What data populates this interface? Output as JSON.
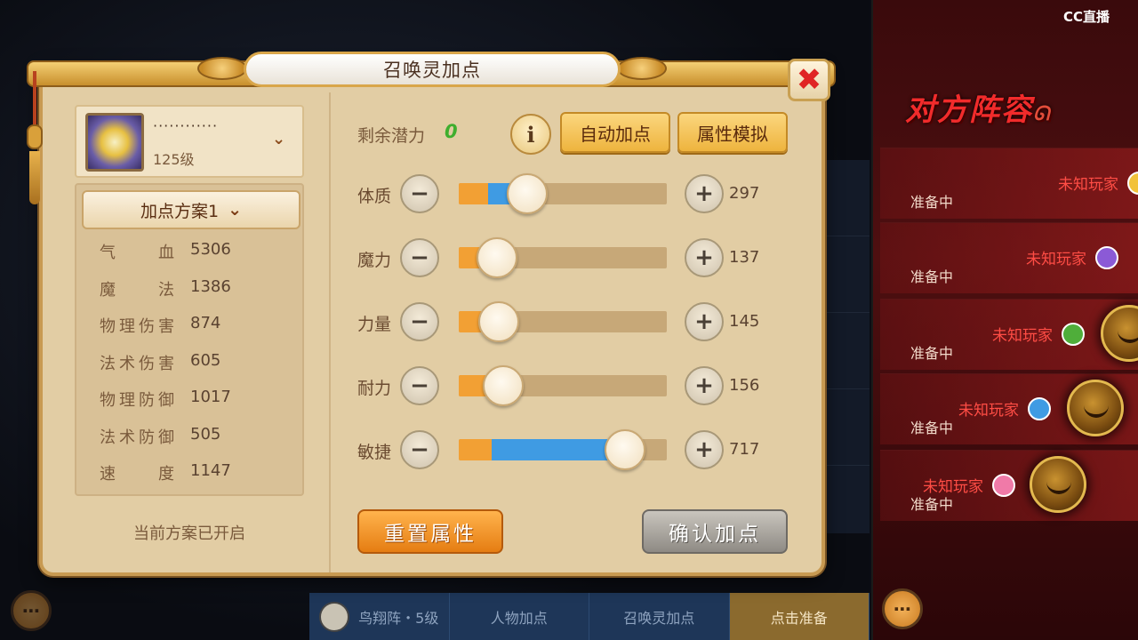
{
  "overlay": {
    "brand": "CC直播"
  },
  "dialog": {
    "title": "召唤灵加点",
    "close_label": "✖"
  },
  "pet": {
    "name": "············",
    "level": "125级",
    "chevron": "⌄"
  },
  "scheme": {
    "label": "加点方案1",
    "chevron": "⌄",
    "status": "当前方案已开启"
  },
  "stats": [
    {
      "label": "气血",
      "value": "5306"
    },
    {
      "label": "魔法",
      "value": "1386"
    },
    {
      "label": "物理伤害",
      "value": "874"
    },
    {
      "label": "法术伤害",
      "value": "605"
    },
    {
      "label": "物理防御",
      "value": "1017"
    },
    {
      "label": "法术防御",
      "value": "505"
    },
    {
      "label": "速度",
      "value": "1147"
    }
  ],
  "potential": {
    "label": "剩余潜力",
    "value": "0"
  },
  "buttons": {
    "info": "i",
    "auto": "自动加点",
    "simulate": "属性模拟",
    "reset": "重置属性",
    "confirm": "确认加点",
    "minus": "−",
    "plus": "+"
  },
  "attributes": [
    {
      "label": "体质",
      "value": "297",
      "base_fraction": 0.14,
      "total_fraction": 0.33
    },
    {
      "label": "魔力",
      "value": "137",
      "base_fraction": 0.14,
      "total_fraction": 0.14
    },
    {
      "label": "力量",
      "value": "145",
      "base_fraction": 0.15,
      "total_fraction": 0.15
    },
    {
      "label": "耐力",
      "value": "156",
      "base_fraction": 0.17,
      "total_fraction": 0.17
    },
    {
      "label": "敏捷",
      "value": "717",
      "base_fraction": 0.16,
      "total_fraction": 0.8
    }
  ],
  "bottom_tabs": [
    "鸟翔阵・5级",
    "人物加点",
    "召唤灵加点",
    "点击准备"
  ],
  "opponent": {
    "title": "对方阵容",
    "players": [
      {
        "name": "未知玩家",
        "status": "准备中",
        "emblem_color": "#f2c23a"
      },
      {
        "name": "未知玩家",
        "status": "准备中",
        "emblem_color": "#8b5ad6"
      },
      {
        "name": "未知玩家",
        "status": "准备中",
        "emblem_color": "#4fae3a"
      },
      {
        "name": "未知玩家",
        "status": "准备中",
        "emblem_color": "#3f9be3"
      },
      {
        "name": "未知玩家",
        "status": "准备中",
        "emblem_color": "#f07aa8"
      }
    ]
  },
  "colors": {
    "potential_value": "#3fae2e",
    "base_fill": "#f2a034",
    "added_fill": "#3f9be3",
    "opponent_name": "#ff4d45"
  }
}
